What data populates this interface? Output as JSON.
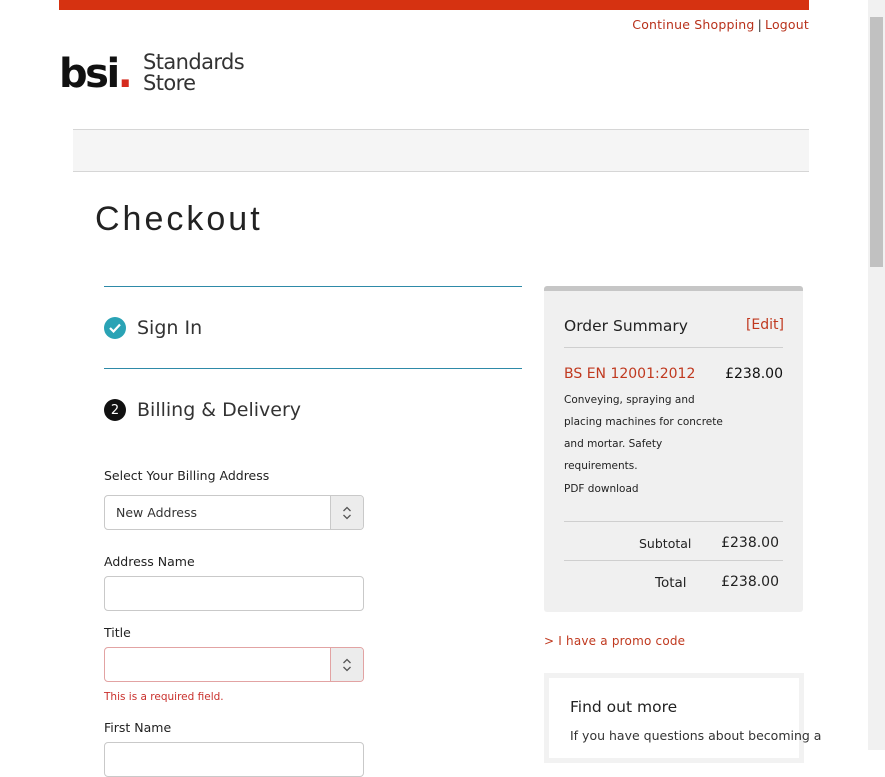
{
  "header": {
    "continue_shopping": "Continue Shopping",
    "separator": "|",
    "logout": "Logout",
    "logo_text": "bsi",
    "logo_dot": ".",
    "store_line1": "Standards",
    "store_line2": "Store"
  },
  "page": {
    "title": "Checkout"
  },
  "steps": {
    "sign_in": "Sign In",
    "billing_number": "2",
    "billing": "Billing & Delivery"
  },
  "form": {
    "billing_address_label": "Select Your Billing Address",
    "billing_address_value": "New Address",
    "address_name_label": "Address Name",
    "address_name_value": "",
    "title_label": "Title",
    "title_value": "",
    "title_error": "This is a required field.",
    "first_name_label": "First Name"
  },
  "summary": {
    "heading": "Order Summary",
    "edit": "[Edit]",
    "product_code": "BS EN 12001:2012",
    "product_price": "£238.00",
    "product_desc": "Conveying, spraying and placing machines for concrete and mortar. Safety requirements.",
    "format": "PDF download",
    "subtotal_label": "Subtotal",
    "subtotal_value": "£238.00",
    "total_label": "Total",
    "total_value": "£238.00"
  },
  "promo": "> I have a promo code",
  "find_out": {
    "heading": "Find out more",
    "text": "If you have questions about becoming a"
  },
  "colors": {
    "accent": "#d63211",
    "link": "#c0391f",
    "teal": "#2aa3b5"
  }
}
